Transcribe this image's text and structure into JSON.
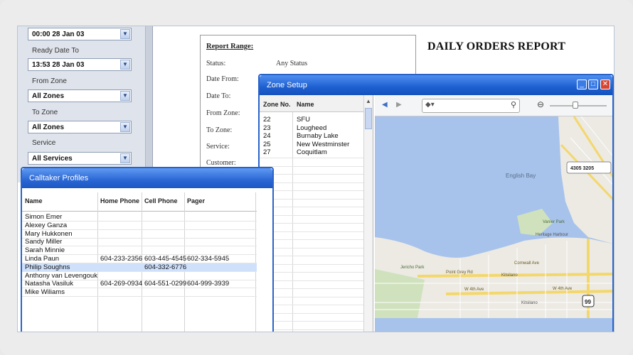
{
  "filters": {
    "first_value": "00:00 28 Jan 03",
    "ready_label": "Ready Date To",
    "ready_value": "13:53 28 Jan 03",
    "from_zone_label": "From Zone",
    "from_zone_value": "All Zones",
    "to_zone_label": "To Zone",
    "to_zone_value": "All Zones",
    "service_label": "Service",
    "service_value": "All Services"
  },
  "report": {
    "title": "DAILY ORDERS REPORT",
    "range_heading": "Report Range:",
    "status_label": "Status:",
    "status_value": "Any Status",
    "date_from_label": "Date From:",
    "date_to_label": "Date To:",
    "from_zone_label": "From Zone:",
    "to_zone_label": "To Zone:",
    "service_label": "Service:",
    "customer_label": "Customer:"
  },
  "zone_setup": {
    "title": "Zone Setup",
    "col_zone": "Zone No.",
    "col_name": "Name",
    "rows": [
      {
        "no": "22",
        "name": "SFU"
      },
      {
        "no": "23",
        "name": "Lougheed"
      },
      {
        "no": "24",
        "name": "Burnaby Lake"
      },
      {
        "no": "25",
        "name": "New Westminster"
      },
      {
        "no": "27",
        "name": "Coquitlam"
      }
    ],
    "map_labels": {
      "english_bay": "English Bay",
      "kitsilano": "Kitsilano",
      "kitsilano2": "Kitsilano",
      "cornwall": "Cornwall Ave",
      "point_grey": "Point Grey Rd",
      "w4th": "W 4th Ave",
      "w4th_b": "W 4th Ave",
      "jericho": "Jericho Park",
      "vanier": "Vanier Park",
      "heritage": "Heritage Harbour",
      "badge": "4305 3205",
      "route": "99"
    }
  },
  "calltaker": {
    "title": "Calltaker Profiles",
    "columns": [
      "Name",
      "Home Phone",
      "Cell Phone",
      "Pager"
    ],
    "rows": [
      {
        "name": "Simon Emer",
        "home": "",
        "cell": "",
        "pager": ""
      },
      {
        "name": "Alexey Ganza",
        "home": "",
        "cell": "",
        "pager": ""
      },
      {
        "name": "Mary Hukkonen",
        "home": "",
        "cell": "",
        "pager": ""
      },
      {
        "name": "Sandy Miller",
        "home": "",
        "cell": "",
        "pager": ""
      },
      {
        "name": "Sarah Minnie",
        "home": "",
        "cell": "",
        "pager": ""
      },
      {
        "name": "Linda Paun",
        "home": "604-233-2356",
        "cell": "603-445-4545",
        "pager": "602-334-5945"
      },
      {
        "name": "Philip Soughns",
        "home": "",
        "cell": "604-332-6776",
        "pager": ""
      },
      {
        "name": "Anthony van Levengouk",
        "home": "",
        "cell": "",
        "pager": ""
      },
      {
        "name": "Natasha Vasiluk",
        "home": "604-269-0934",
        "cell": "604-551-0299",
        "pager": "604-999-3939"
      },
      {
        "name": "Mike Wiliams",
        "home": "",
        "cell": "",
        "pager": ""
      }
    ],
    "selected_index": 6
  },
  "colors": {
    "title_bar": "#1d5fd0",
    "selection": "#cfe0fb",
    "water": "#a7c3ec",
    "land": "#eceae3"
  }
}
